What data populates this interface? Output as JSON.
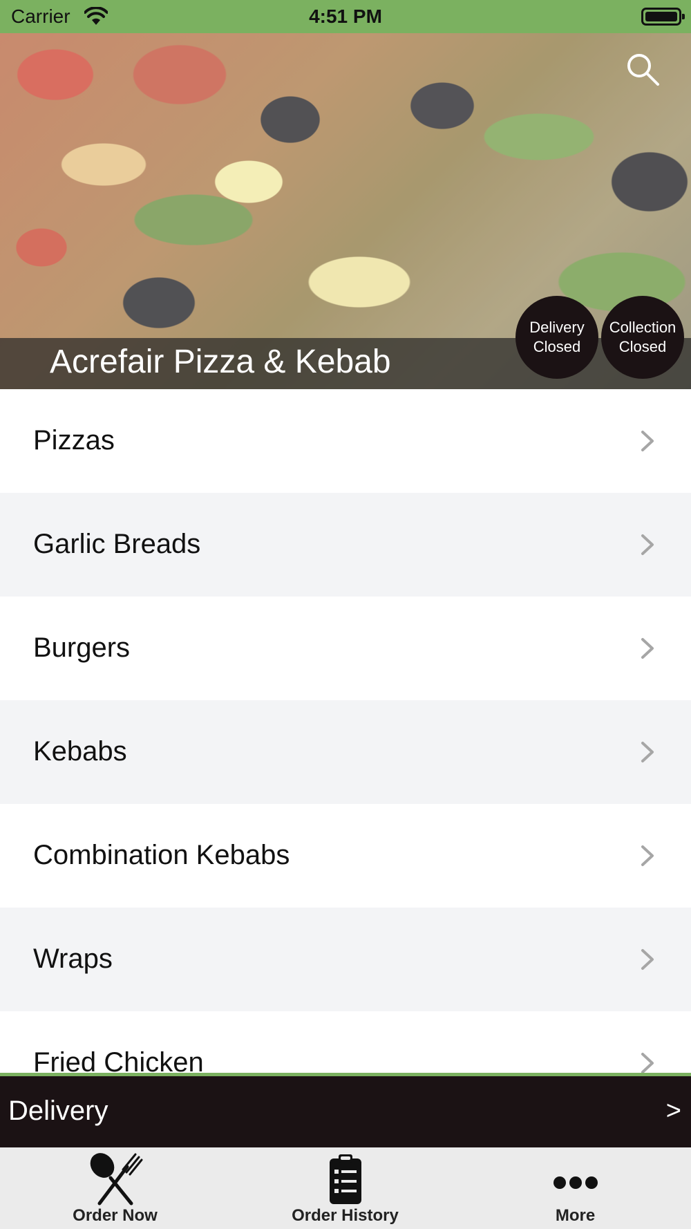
{
  "status_bar": {
    "carrier": "Carrier",
    "time": "4:51 PM"
  },
  "header": {
    "restaurant_name": "Acrefair Pizza & Kebab",
    "delivery_badge": {
      "line1": "Delivery",
      "line2": "Closed"
    },
    "collection_badge": {
      "line1": "Collection",
      "line2": "Closed"
    },
    "search_icon": "search-icon"
  },
  "categories": [
    "Pizzas",
    "Garlic Breads",
    "Burgers",
    "Kebabs",
    "Combination Kebabs",
    "Wraps",
    "Fried Chicken"
  ],
  "order_mode_bar": {
    "label": "Delivery",
    "arrow": ">"
  },
  "tab_bar": {
    "tabs": [
      {
        "label": "Order Now",
        "icon": "knife-fork-icon"
      },
      {
        "label": "Order History",
        "icon": "clipboard-icon"
      },
      {
        "label": "More",
        "icon": "more-dots-icon"
      }
    ]
  },
  "colors": {
    "accent": "#7bb160",
    "dark": "#1b1214",
    "row_alt": "#f3f4f6",
    "tab_bg": "#ebebeb"
  }
}
